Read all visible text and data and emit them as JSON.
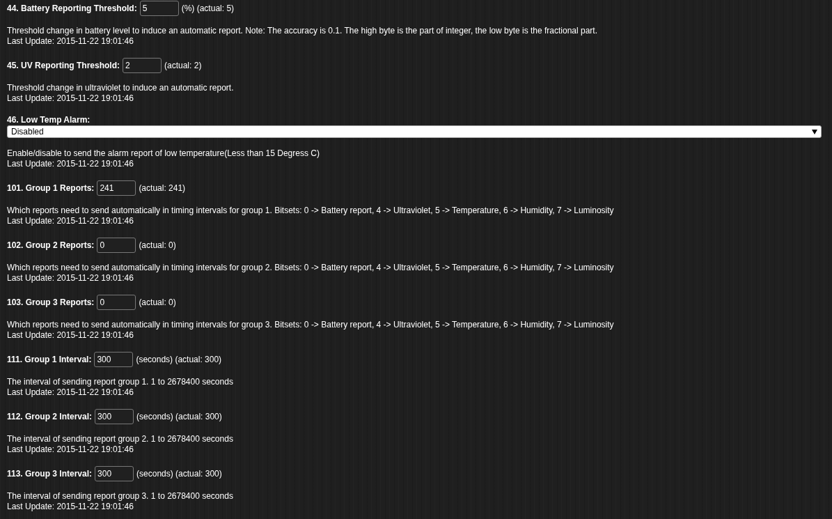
{
  "parameters": [
    {
      "kind": "number",
      "label": "44. Battery Reporting Threshold:",
      "value": "5",
      "suffix": "(%) (actual: 5)",
      "description": "Threshold change in battery level to induce an automatic report. Note: The accuracy is 0.1. The high byte is the part of integer, the low byte is the fractional part.",
      "last_update": "Last Update: 2015-11-22 19:01:46"
    },
    {
      "kind": "number",
      "label": "45. UV Reporting Threshold:",
      "value": "2",
      "suffix": "(actual: 2)",
      "description": "Threshold change in ultraviolet to induce an automatic report.",
      "last_update": "Last Update: 2015-11-22 19:01:46"
    },
    {
      "kind": "select",
      "label": "46. Low Temp Alarm:",
      "value": "Disabled",
      "description": "Enable/disable to send the alarm report of low temperature(Less than 15 Degress C)",
      "last_update": "Last Update: 2015-11-22 19:01:46"
    },
    {
      "kind": "number",
      "label": "101. Group 1 Reports:",
      "value": "241",
      "suffix": "(actual: 241)",
      "description": "Which reports need to send automatically in timing intervals for group 1. Bitsets: 0 -> Battery report, 4 -> Ultraviolet, 5 -> Temperature, 6 -> Humidity, 7 -> Luminosity",
      "last_update": "Last Update: 2015-11-22 19:01:46"
    },
    {
      "kind": "number",
      "label": "102. Group 2 Reports:",
      "value": "0",
      "suffix": "(actual: 0)",
      "description": "Which reports need to send automatically in timing intervals for group 2. Bitsets: 0 -> Battery report, 4 -> Ultraviolet, 5 -> Temperature, 6 -> Humidity, 7 -> Luminosity",
      "last_update": "Last Update: 2015-11-22 19:01:46"
    },
    {
      "kind": "number",
      "label": "103. Group 3 Reports:",
      "value": "0",
      "suffix": "(actual: 0)",
      "description": "Which reports need to send automatically in timing intervals for group 3. Bitsets: 0 -> Battery report, 4 -> Ultraviolet, 5 -> Temperature, 6 -> Humidity, 7 -> Luminosity",
      "last_update": "Last Update: 2015-11-22 19:01:46"
    },
    {
      "kind": "number",
      "label": "111. Group 1 Interval:",
      "value": "300",
      "suffix": "(seconds) (actual: 300)",
      "description": "The interval of sending report group 1. 1 to 2678400 seconds",
      "last_update": "Last Update: 2015-11-22 19:01:46"
    },
    {
      "kind": "number",
      "label": "112. Group 2 Interval:",
      "value": "300",
      "suffix": "(seconds) (actual: 300)",
      "description": "The interval of sending report group 2. 1 to 2678400 seconds",
      "last_update": "Last Update: 2015-11-22 19:01:46"
    },
    {
      "kind": "number",
      "label": "113. Group 3 Interval:",
      "value": "300",
      "suffix": "(seconds) (actual: 300)",
      "description": "The interval of sending report group 3. 1 to 2678400 seconds",
      "last_update": "Last Update: 2015-11-22 19:01:46"
    }
  ]
}
